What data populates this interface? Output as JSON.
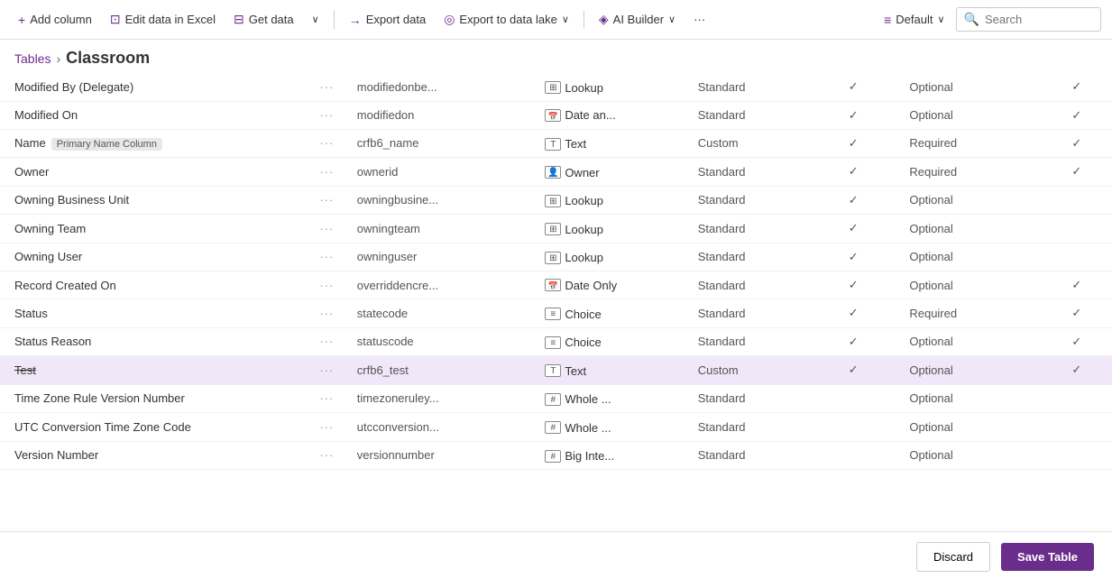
{
  "toolbar": {
    "add_column_label": "Add column",
    "edit_excel_label": "Edit data in Excel",
    "get_data_label": "Get data",
    "export_data_label": "Export data",
    "export_lake_label": "Export to data lake",
    "ai_builder_label": "AI Builder",
    "more_label": "···",
    "default_label": "Default",
    "search_label": "Search",
    "search_placeholder": "Search"
  },
  "breadcrumb": {
    "tables_label": "Tables",
    "chevron": "›",
    "current": "Classroom"
  },
  "table": {
    "rows": [
      {
        "name": "Modified By (Delegate)",
        "logicalName": "modifiedonbe...",
        "typeIcon": "⊞",
        "typeName": "Lookup",
        "custom": "Standard",
        "searchable": true,
        "requirement": "Optional",
        "managed": true,
        "isPrimary": false,
        "selected": false,
        "strikethrough": false
      },
      {
        "name": "Modified On",
        "logicalName": "modifiedon",
        "typeIcon": "📅",
        "typeName": "Date an...",
        "custom": "Standard",
        "searchable": true,
        "requirement": "Optional",
        "managed": true,
        "isPrimary": false,
        "selected": false,
        "strikethrough": false
      },
      {
        "name": "Name",
        "logicalName": "crfb6_name",
        "typeIcon": "T",
        "typeName": "Text",
        "custom": "Custom",
        "searchable": true,
        "requirement": "Required",
        "managed": true,
        "isPrimary": true,
        "selected": false,
        "strikethrough": false
      },
      {
        "name": "Owner",
        "logicalName": "ownerid",
        "typeIcon": "👤",
        "typeName": "Owner",
        "custom": "Standard",
        "searchable": true,
        "requirement": "Required",
        "managed": true,
        "isPrimary": false,
        "selected": false,
        "strikethrough": false
      },
      {
        "name": "Owning Business Unit",
        "logicalName": "owningbusine...",
        "typeIcon": "⊞",
        "typeName": "Lookup",
        "custom": "Standard",
        "searchable": true,
        "requirement": "Optional",
        "managed": false,
        "isPrimary": false,
        "selected": false,
        "strikethrough": false
      },
      {
        "name": "Owning Team",
        "logicalName": "owningteam",
        "typeIcon": "⊞",
        "typeName": "Lookup",
        "custom": "Standard",
        "searchable": true,
        "requirement": "Optional",
        "managed": false,
        "isPrimary": false,
        "selected": false,
        "strikethrough": false
      },
      {
        "name": "Owning User",
        "logicalName": "owninguser",
        "typeIcon": "⊞",
        "typeName": "Lookup",
        "custom": "Standard",
        "searchable": true,
        "requirement": "Optional",
        "managed": false,
        "isPrimary": false,
        "selected": false,
        "strikethrough": false
      },
      {
        "name": "Record Created On",
        "logicalName": "overriddencre...",
        "typeIcon": "📅",
        "typeName": "Date Only",
        "custom": "Standard",
        "searchable": true,
        "requirement": "Optional",
        "managed": true,
        "isPrimary": false,
        "selected": false,
        "strikethrough": false
      },
      {
        "name": "Status",
        "logicalName": "statecode",
        "typeIcon": "≡",
        "typeName": "Choice",
        "custom": "Standard",
        "searchable": true,
        "requirement": "Required",
        "managed": true,
        "isPrimary": false,
        "selected": false,
        "strikethrough": false
      },
      {
        "name": "Status Reason",
        "logicalName": "statuscode",
        "typeIcon": "≡",
        "typeName": "Choice",
        "custom": "Standard",
        "searchable": true,
        "requirement": "Optional",
        "managed": true,
        "isPrimary": false,
        "selected": false,
        "strikethrough": false
      },
      {
        "name": "Test",
        "logicalName": "crfb6_test",
        "typeIcon": "T",
        "typeName": "Text",
        "custom": "Custom",
        "searchable": true,
        "requirement": "Optional",
        "managed": true,
        "isPrimary": false,
        "selected": true,
        "strikethrough": true
      },
      {
        "name": "Time Zone Rule Version Number",
        "logicalName": "timezoneruley...",
        "typeIcon": "#",
        "typeName": "Whole ...",
        "custom": "Standard",
        "searchable": false,
        "requirement": "Optional",
        "managed": false,
        "isPrimary": false,
        "selected": false,
        "strikethrough": false
      },
      {
        "name": "UTC Conversion Time Zone Code",
        "logicalName": "utcconversion...",
        "typeIcon": "#",
        "typeName": "Whole ...",
        "custom": "Standard",
        "searchable": false,
        "requirement": "Optional",
        "managed": false,
        "isPrimary": false,
        "selected": false,
        "strikethrough": false
      },
      {
        "name": "Version Number",
        "logicalName": "versionnumber",
        "typeIcon": "#",
        "typeName": "Big Inte...",
        "custom": "Standard",
        "searchable": false,
        "requirement": "Optional",
        "managed": false,
        "isPrimary": false,
        "selected": false,
        "strikethrough": false
      }
    ]
  },
  "footer": {
    "discard_label": "Discard",
    "save_label": "Save Table"
  },
  "icons": {
    "add": "+",
    "excel": "⊡",
    "data": "⊟",
    "export": "→",
    "lake": "◎",
    "ai": "◈",
    "more": "···",
    "default": "≡",
    "search": "🔍",
    "chevron_down": "∨",
    "chevron_right": "›"
  }
}
